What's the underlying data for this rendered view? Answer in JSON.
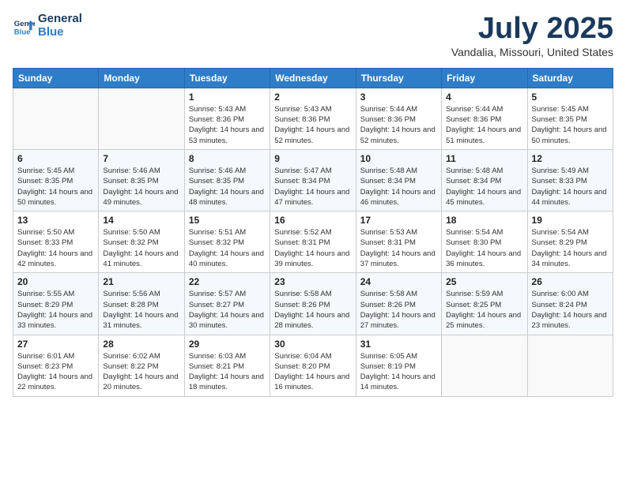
{
  "header": {
    "logo_line1": "General",
    "logo_line2": "Blue",
    "month": "July 2025",
    "location": "Vandalia, Missouri, United States"
  },
  "weekdays": [
    "Sunday",
    "Monday",
    "Tuesday",
    "Wednesday",
    "Thursday",
    "Friday",
    "Saturday"
  ],
  "weeks": [
    [
      {
        "day": "",
        "info": ""
      },
      {
        "day": "",
        "info": ""
      },
      {
        "day": "1",
        "info": "Sunrise: 5:43 AM\nSunset: 8:36 PM\nDaylight: 14 hours and 53 minutes."
      },
      {
        "day": "2",
        "info": "Sunrise: 5:43 AM\nSunset: 8:36 PM\nDaylight: 14 hours and 52 minutes."
      },
      {
        "day": "3",
        "info": "Sunrise: 5:44 AM\nSunset: 8:36 PM\nDaylight: 14 hours and 52 minutes."
      },
      {
        "day": "4",
        "info": "Sunrise: 5:44 AM\nSunset: 8:36 PM\nDaylight: 14 hours and 51 minutes."
      },
      {
        "day": "5",
        "info": "Sunrise: 5:45 AM\nSunset: 8:35 PM\nDaylight: 14 hours and 50 minutes."
      }
    ],
    [
      {
        "day": "6",
        "info": "Sunrise: 5:45 AM\nSunset: 8:35 PM\nDaylight: 14 hours and 50 minutes."
      },
      {
        "day": "7",
        "info": "Sunrise: 5:46 AM\nSunset: 8:35 PM\nDaylight: 14 hours and 49 minutes."
      },
      {
        "day": "8",
        "info": "Sunrise: 5:46 AM\nSunset: 8:35 PM\nDaylight: 14 hours and 48 minutes."
      },
      {
        "day": "9",
        "info": "Sunrise: 5:47 AM\nSunset: 8:34 PM\nDaylight: 14 hours and 47 minutes."
      },
      {
        "day": "10",
        "info": "Sunrise: 5:48 AM\nSunset: 8:34 PM\nDaylight: 14 hours and 46 minutes."
      },
      {
        "day": "11",
        "info": "Sunrise: 5:48 AM\nSunset: 8:34 PM\nDaylight: 14 hours and 45 minutes."
      },
      {
        "day": "12",
        "info": "Sunrise: 5:49 AM\nSunset: 8:33 PM\nDaylight: 14 hours and 44 minutes."
      }
    ],
    [
      {
        "day": "13",
        "info": "Sunrise: 5:50 AM\nSunset: 8:33 PM\nDaylight: 14 hours and 42 minutes."
      },
      {
        "day": "14",
        "info": "Sunrise: 5:50 AM\nSunset: 8:32 PM\nDaylight: 14 hours and 41 minutes."
      },
      {
        "day": "15",
        "info": "Sunrise: 5:51 AM\nSunset: 8:32 PM\nDaylight: 14 hours and 40 minutes."
      },
      {
        "day": "16",
        "info": "Sunrise: 5:52 AM\nSunset: 8:31 PM\nDaylight: 14 hours and 39 minutes."
      },
      {
        "day": "17",
        "info": "Sunrise: 5:53 AM\nSunset: 8:31 PM\nDaylight: 14 hours and 37 minutes."
      },
      {
        "day": "18",
        "info": "Sunrise: 5:54 AM\nSunset: 8:30 PM\nDaylight: 14 hours and 36 minutes."
      },
      {
        "day": "19",
        "info": "Sunrise: 5:54 AM\nSunset: 8:29 PM\nDaylight: 14 hours and 34 minutes."
      }
    ],
    [
      {
        "day": "20",
        "info": "Sunrise: 5:55 AM\nSunset: 8:29 PM\nDaylight: 14 hours and 33 minutes."
      },
      {
        "day": "21",
        "info": "Sunrise: 5:56 AM\nSunset: 8:28 PM\nDaylight: 14 hours and 31 minutes."
      },
      {
        "day": "22",
        "info": "Sunrise: 5:57 AM\nSunset: 8:27 PM\nDaylight: 14 hours and 30 minutes."
      },
      {
        "day": "23",
        "info": "Sunrise: 5:58 AM\nSunset: 8:26 PM\nDaylight: 14 hours and 28 minutes."
      },
      {
        "day": "24",
        "info": "Sunrise: 5:58 AM\nSunset: 8:26 PM\nDaylight: 14 hours and 27 minutes."
      },
      {
        "day": "25",
        "info": "Sunrise: 5:59 AM\nSunset: 8:25 PM\nDaylight: 14 hours and 25 minutes."
      },
      {
        "day": "26",
        "info": "Sunrise: 6:00 AM\nSunset: 8:24 PM\nDaylight: 14 hours and 23 minutes."
      }
    ],
    [
      {
        "day": "27",
        "info": "Sunrise: 6:01 AM\nSunset: 8:23 PM\nDaylight: 14 hours and 22 minutes."
      },
      {
        "day": "28",
        "info": "Sunrise: 6:02 AM\nSunset: 8:22 PM\nDaylight: 14 hours and 20 minutes."
      },
      {
        "day": "29",
        "info": "Sunrise: 6:03 AM\nSunset: 8:21 PM\nDaylight: 14 hours and 18 minutes."
      },
      {
        "day": "30",
        "info": "Sunrise: 6:04 AM\nSunset: 8:20 PM\nDaylight: 14 hours and 16 minutes."
      },
      {
        "day": "31",
        "info": "Sunrise: 6:05 AM\nSunset: 8:19 PM\nDaylight: 14 hours and 14 minutes."
      },
      {
        "day": "",
        "info": ""
      },
      {
        "day": "",
        "info": ""
      }
    ]
  ]
}
